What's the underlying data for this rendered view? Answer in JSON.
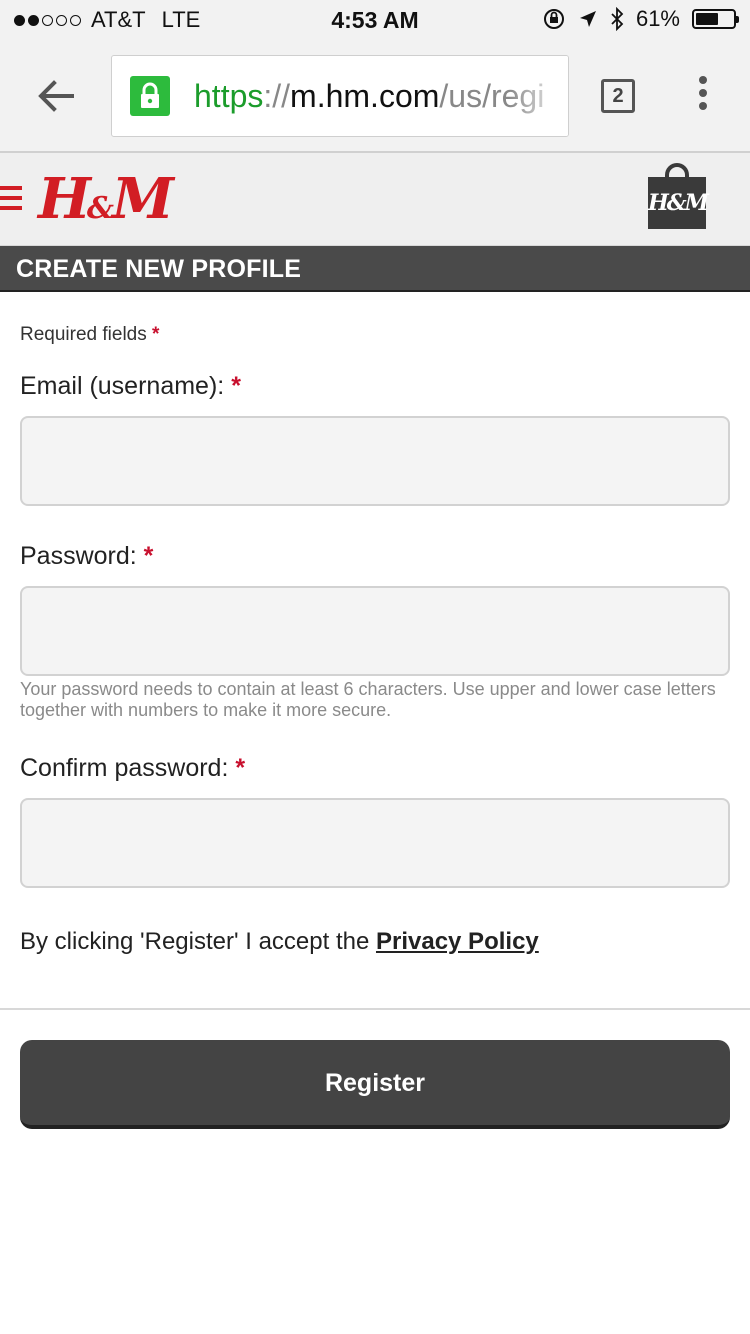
{
  "status_bar": {
    "carrier": "AT&T",
    "network": "LTE",
    "time": "4:53 AM",
    "battery": "61%",
    "battery_level": 0.61
  },
  "browser": {
    "url_scheme": "https",
    "url_separator": "://",
    "url_host": "m.hm.com",
    "url_path": "/us/regi",
    "tab_count": "2"
  },
  "header": {
    "logo_left": "H",
    "logo_amp": "&",
    "logo_right": "M",
    "bag_logo": "H&M"
  },
  "page": {
    "title": "CREATE NEW PROFILE",
    "required_note": "Required fields",
    "required_star": "*"
  },
  "form": {
    "email_label": "Email (username):",
    "password_label": "Password:",
    "password_hint": "Your password needs to contain at least 6 characters. Use upper and lower case letters together with numbers to make it more secure.",
    "confirm_label": "Confirm password:",
    "email_value": "",
    "password_value": "",
    "confirm_value": ""
  },
  "policy": {
    "text": "By clicking 'Register' I accept the ",
    "link": "Privacy Policy"
  },
  "actions": {
    "register_label": "Register"
  },
  "colors": {
    "brand_red": "#d21d24",
    "lock_green": "#2dbb3d",
    "dark_button": "#444444"
  }
}
